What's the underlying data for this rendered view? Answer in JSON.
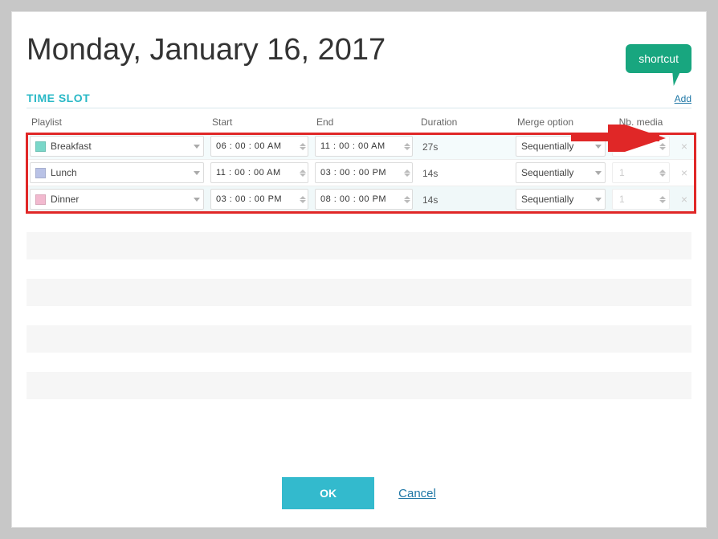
{
  "title": "Monday, January 16, 2017",
  "section_label": "TIME SLOT",
  "add_link": "Add",
  "callout": "shortcut",
  "headers": {
    "playlist": "Playlist",
    "start": "Start",
    "end": "End",
    "duration": "Duration",
    "merge": "Merge option",
    "nb": "Nb. media"
  },
  "rows": [
    {
      "color": "#7ad7c9",
      "name": "Breakfast",
      "start": "06 : 00 : 00 AM",
      "end": "11 : 00 : 00 AM",
      "duration": "27s",
      "merge": "Sequentially",
      "nb": "1"
    },
    {
      "color": "#b9c2e6",
      "name": "Lunch",
      "start": "11 : 00 : 00 AM",
      "end": "03 : 00 : 00 PM",
      "duration": "14s",
      "merge": "Sequentially",
      "nb": "1"
    },
    {
      "color": "#f2b9cf",
      "name": "Dinner",
      "start": "03 : 00 : 00 PM",
      "end": "08 : 00 : 00 PM",
      "duration": "14s",
      "merge": "Sequentially",
      "nb": "1"
    }
  ],
  "buttons": {
    "ok": "OK",
    "cancel": "Cancel"
  }
}
